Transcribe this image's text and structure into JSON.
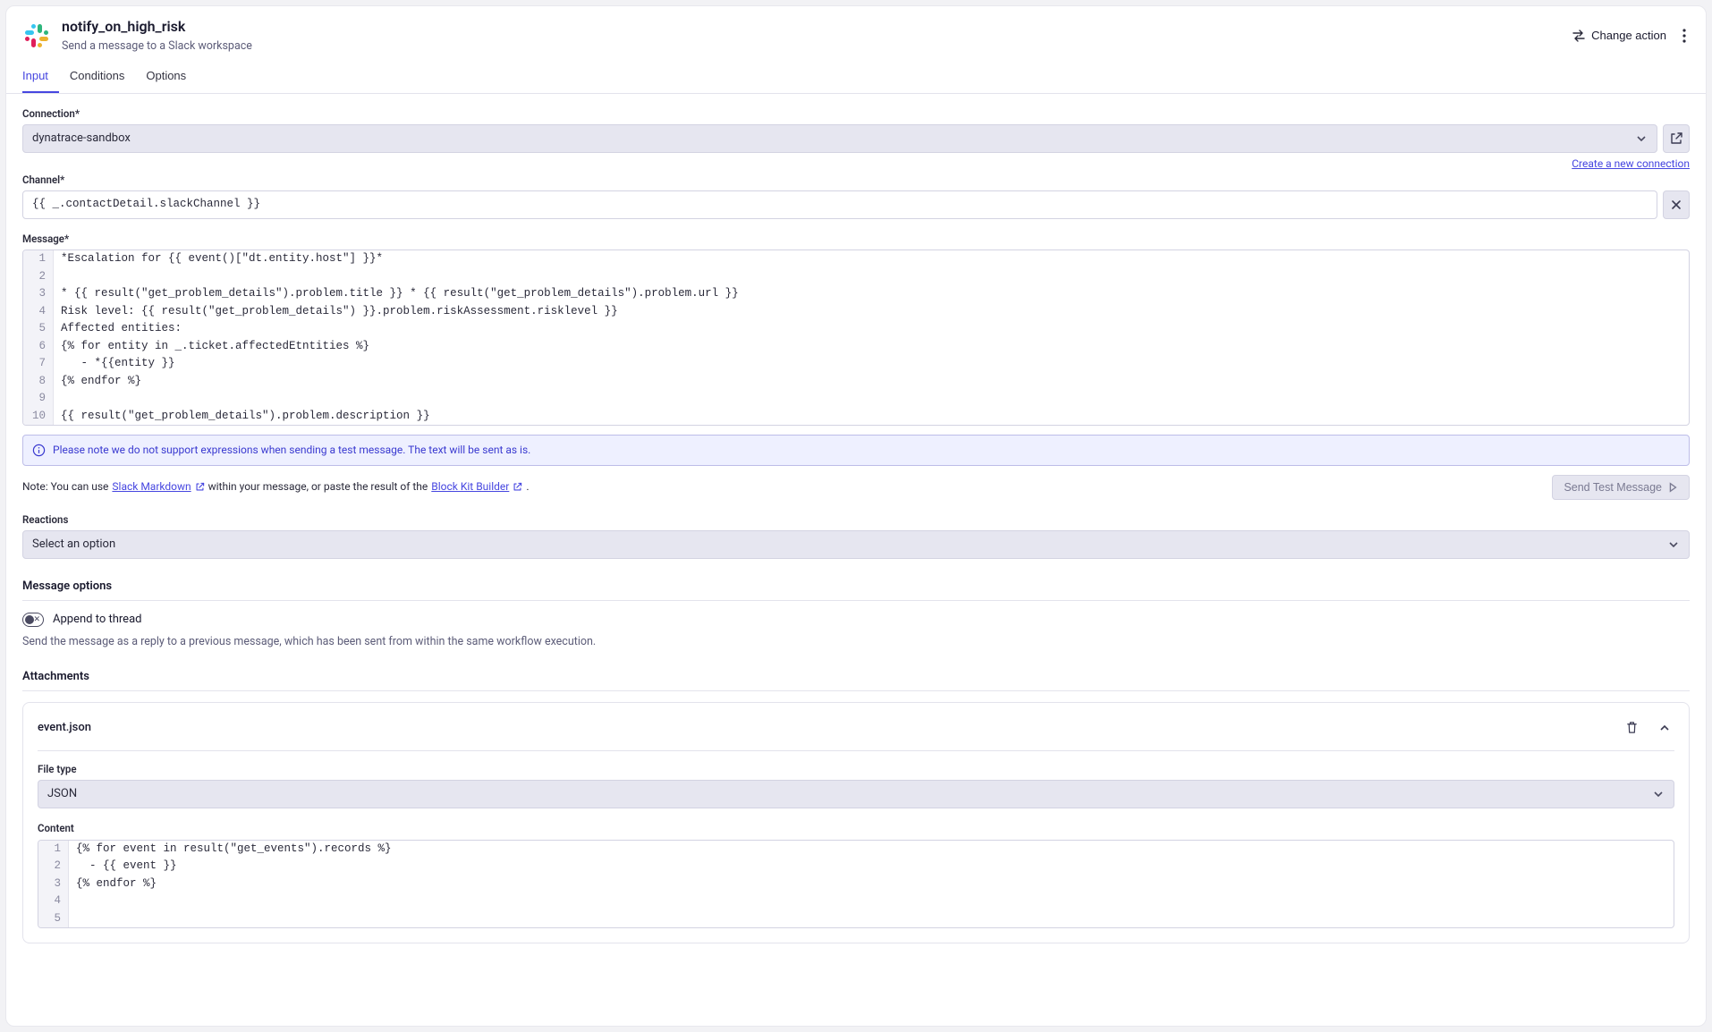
{
  "header": {
    "title": "notify_on_high_risk",
    "subtitle": "Send a message to a Slack workspace",
    "change_action": "Change action"
  },
  "tabs": [
    "Input",
    "Conditions",
    "Options"
  ],
  "connection": {
    "label": "Connection*",
    "value": "dynatrace-sandbox",
    "create_link": "Create a new connection"
  },
  "channel": {
    "label": "Channel*",
    "value": "{{ _.contactDetail.slackChannel }}"
  },
  "message": {
    "label": "Message*",
    "lines": [
      "*Escalation for {{ event()[\"dt.entity.host\"] }}*",
      "",
      "* {{ result(\"get_problem_details\").problem.title }} * {{ result(\"get_problem_details\").problem.url }}",
      "Risk level: {{ result(\"get_problem_details\") }}.problem.riskAssessment.risklevel }}",
      "Affected entities:",
      "{% for entity in _.ticket.affectedEtntities %}",
      "   - *{{entity }}",
      "{% endfor %}",
      "",
      "{{ result(\"get_problem_details\").problem.description }}"
    ]
  },
  "info_banner": "Please note we do not support expressions when sending a test message. The text will be sent as is.",
  "note": {
    "prefix": "Note: You can use",
    "slack_link": "Slack Markdown",
    "mid": "within your message, or paste the result of the",
    "block_link": "Block Kit Builder",
    "suffix": "."
  },
  "send_test": "Send Test Message",
  "reactions": {
    "label": "Reactions",
    "placeholder": "Select an option"
  },
  "message_options": {
    "title": "Message options",
    "append_label": "Append to thread",
    "append_desc": "Send the message as a reply to a previous message, which has been sent from within the same workflow execution."
  },
  "attachments": {
    "title": "Attachments",
    "item": {
      "name": "event.json",
      "file_type_label": "File type",
      "file_type_value": "JSON",
      "content_label": "Content",
      "lines": [
        "{% for event in result(\"get_events\").records %}",
        "  - {{ event }}",
        "{% endfor %}",
        "",
        ""
      ]
    }
  }
}
